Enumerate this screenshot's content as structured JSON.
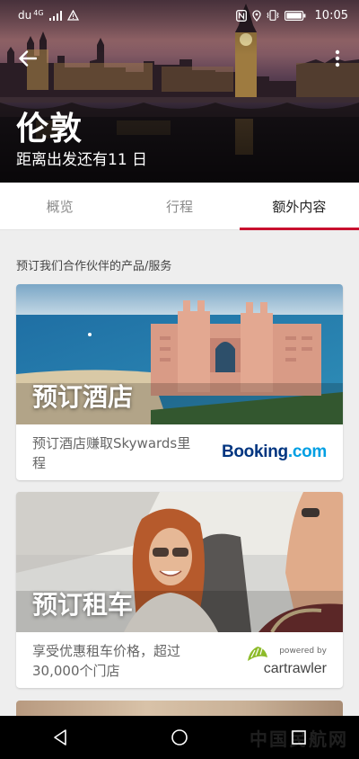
{
  "status_bar": {
    "carrier": "du",
    "network": "4G",
    "time": "10:05"
  },
  "header": {
    "back_icon": "arrow-left-icon",
    "more_icon": "more-vertical-icon",
    "city": "伦敦",
    "countdown": "距离出发还有11 日"
  },
  "tabs": [
    {
      "label": "概览",
      "active": false
    },
    {
      "label": "行程",
      "active": false
    },
    {
      "label": "额外内容",
      "active": true
    }
  ],
  "accent_color": "#c8102e",
  "main": {
    "section_title": "预订我们合作伙伴的产品/服务",
    "cards": [
      {
        "title": "预订酒店",
        "description": "预订酒店赚取Skywards里程",
        "brand_part1": "Booking",
        "brand_part2": ".com"
      },
      {
        "title": "预订租车",
        "description": "享受优惠租车价格，超过30,000个门店",
        "brand_powered": "powered by",
        "brand_name": "cartrawler"
      }
    ]
  },
  "nav": {
    "back_icon": "nav-back-icon",
    "home_icon": "nav-home-icon",
    "recent_icon": "nav-recent-icon"
  },
  "watermark": "中国民航网"
}
